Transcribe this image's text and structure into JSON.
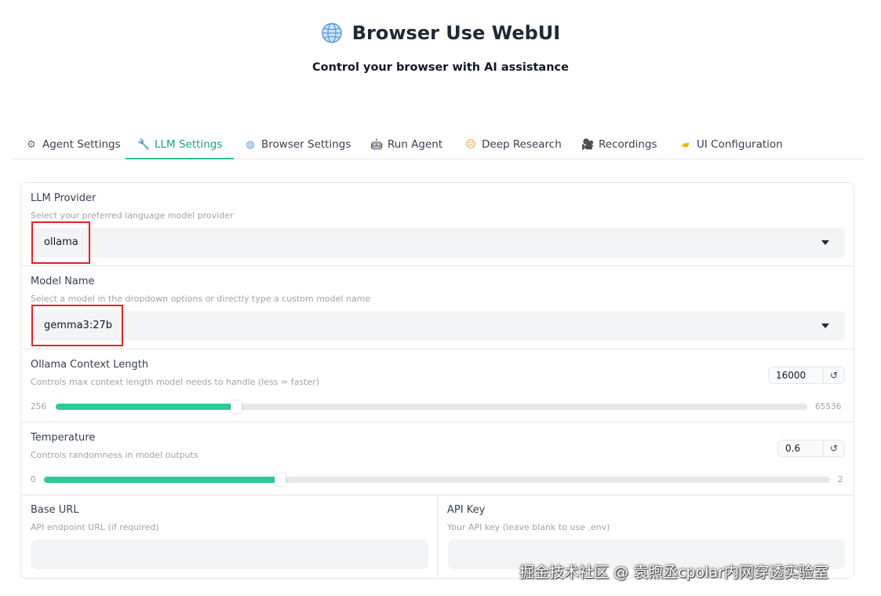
{
  "app": {
    "title": "Browser Use WebUI",
    "subtitle": "Control your browser with AI assistance",
    "icon": "globe-icon"
  },
  "tabs": [
    {
      "label": "Agent Settings",
      "icon": "gear-icon",
      "active": false
    },
    {
      "label": "LLM Settings",
      "icon": "wrench-icon",
      "active": true
    },
    {
      "label": "Browser Settings",
      "icon": "globe-icon",
      "active": false
    },
    {
      "label": "Run Agent",
      "icon": "robot-icon",
      "active": false
    },
    {
      "label": "Deep Research",
      "icon": "thinking-face-icon",
      "active": false
    },
    {
      "label": "Recordings",
      "icon": "movie-camera-icon",
      "active": false
    },
    {
      "label": "UI Configuration",
      "icon": "folder-icon",
      "active": false
    }
  ],
  "llm_settings": {
    "provider": {
      "label": "LLM Provider",
      "info": "Select your preferred language model provider",
      "value": "ollama"
    },
    "model_name": {
      "label": "Model Name",
      "info": "Select a model in the dropdown options or directly type a custom model name",
      "value": "gemma3:27b"
    },
    "context_length": {
      "label": "Ollama Context Length",
      "info": "Controls max context length model needs to handle (less = faster)",
      "value": "16000",
      "min": "256",
      "max": "65536",
      "fraction": 0.24
    },
    "temperature": {
      "label": "Temperature",
      "info": "Controls randomness in model outputs",
      "value": "0.6",
      "min": "0",
      "max": "2",
      "fraction": 0.3
    },
    "base_url": {
      "label": "Base URL",
      "info": "API endpoint URL (if required)",
      "value": ""
    },
    "api_key": {
      "label": "API Key",
      "info": "Your API key (leave blank to use .env)",
      "value": ""
    },
    "reset_icon": "↺"
  },
  "watermark": "掘金技术社区 @ 袁煦丞cpolar内网穿透实验室",
  "colors": {
    "accent": "#2ecc95",
    "active_tab": "#16a37f",
    "highlight": "#e02424"
  }
}
